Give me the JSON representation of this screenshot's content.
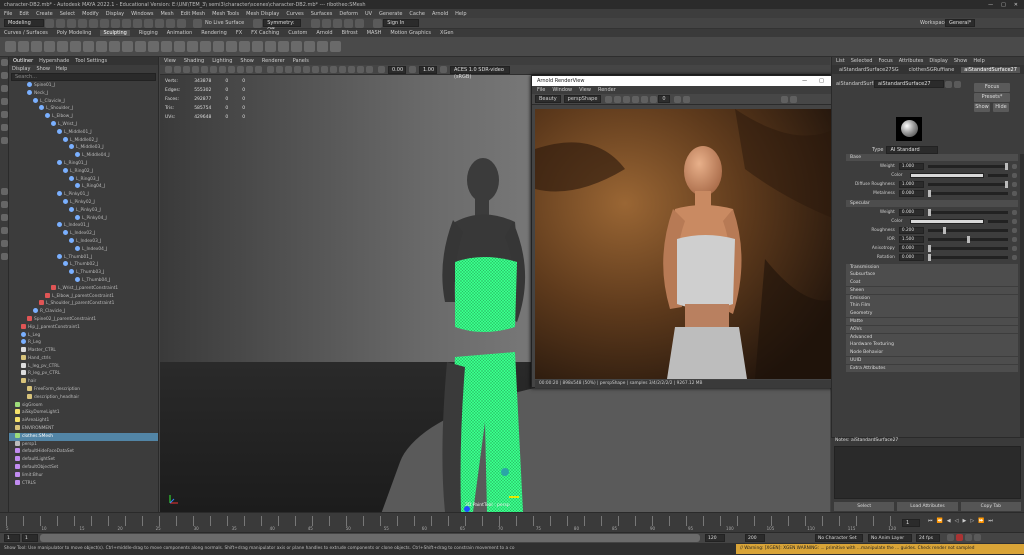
{
  "window": {
    "title": "character-DB2.mb* - Autodesk MAYA 2022.1 - Educational Version: E:\\UNI\\TEM_3\\ semi3\\character\\scenes\\character-DB2.mb* --- ribotheo:SMesh",
    "controls": [
      "—",
      "□",
      "✕"
    ]
  },
  "menubar": [
    "File",
    "Edit",
    "Create",
    "Select",
    "Modify",
    "Display",
    "Windows",
    "Mesh",
    "Edit Mesh",
    "Mesh Tools",
    "Mesh Display",
    "Curves",
    "Surfaces",
    "Deform",
    "UV",
    "Generate",
    "Cache",
    "Arnold",
    "Help"
  ],
  "statusline": {
    "mode": "Modeling",
    "live": "No Live Surface",
    "symmetry": "Symmetry: Off",
    "signin": "Sign In",
    "workspace_label": "Workspace:",
    "workspace": "General*"
  },
  "shelftabs": {
    "items": [
      "Curves / Surfaces",
      "Poly Modeling",
      "Sculpting",
      "Rigging",
      "Animation",
      "Rendering",
      "FX",
      "FX Caching",
      "Custom",
      "Arnold",
      "Bifrost",
      "MASH",
      "Motion Graphics",
      "XGen"
    ],
    "active": "Sculpting"
  },
  "outliner": {
    "tabs": [
      "Outliner",
      "Hypershade",
      "Tool Settings"
    ],
    "active_tab": "Outliner",
    "menu": [
      "Display",
      "Show",
      "Help"
    ],
    "search_placeholder": "Search...",
    "items": [
      {
        "label": "Spine01_J",
        "depth": 2,
        "kind": "joint"
      },
      {
        "label": "Neck_J",
        "depth": 2,
        "kind": "joint"
      },
      {
        "label": "L_Clavicle_J",
        "depth": 3,
        "kind": "joint"
      },
      {
        "label": "L_Shoulder_J",
        "depth": 4,
        "kind": "joint"
      },
      {
        "label": "L_Elbow_J",
        "depth": 5,
        "kind": "joint"
      },
      {
        "label": "L_Wrist_J",
        "depth": 6,
        "kind": "joint"
      },
      {
        "label": "L_Middle01_J",
        "depth": 7,
        "kind": "joint"
      },
      {
        "label": "L_Middle02_J",
        "depth": 8,
        "kind": "joint"
      },
      {
        "label": "L_Middle03_J",
        "depth": 9,
        "kind": "joint"
      },
      {
        "label": "L_Middle04_J",
        "depth": 10,
        "kind": "joint"
      },
      {
        "label": "L_Ring01_J",
        "depth": 7,
        "kind": "joint"
      },
      {
        "label": "L_Ring02_J",
        "depth": 8,
        "kind": "joint"
      },
      {
        "label": "L_Ring03_J",
        "depth": 9,
        "kind": "joint"
      },
      {
        "label": "L_Ring04_J",
        "depth": 10,
        "kind": "joint"
      },
      {
        "label": "L_Pinky01_J",
        "depth": 7,
        "kind": "joint"
      },
      {
        "label": "L_Pinky02_J",
        "depth": 8,
        "kind": "joint"
      },
      {
        "label": "L_Pinky03_J",
        "depth": 9,
        "kind": "joint"
      },
      {
        "label": "L_Pinky04_J",
        "depth": 10,
        "kind": "joint"
      },
      {
        "label": "L_Index01_J",
        "depth": 7,
        "kind": "joint"
      },
      {
        "label": "L_Index02_J",
        "depth": 8,
        "kind": "joint"
      },
      {
        "label": "L_Index03_J",
        "depth": 9,
        "kind": "joint"
      },
      {
        "label": "L_Index04_J",
        "depth": 10,
        "kind": "joint"
      },
      {
        "label": "L_Thumb01_J",
        "depth": 7,
        "kind": "joint"
      },
      {
        "label": "L_Thumb02_J",
        "depth": 8,
        "kind": "joint"
      },
      {
        "label": "L_Thumb03_J",
        "depth": 9,
        "kind": "joint"
      },
      {
        "label": "L_Thumb04_J",
        "depth": 10,
        "kind": "joint"
      },
      {
        "label": "L_Wrist_J_parentConstraint1",
        "depth": 6,
        "kind": "constraint"
      },
      {
        "label": "L_Elbow_J_parentConstraint1",
        "depth": 5,
        "kind": "constraint"
      },
      {
        "label": "L_Shoulder_J_parentConstraint1",
        "depth": 4,
        "kind": "constraint"
      },
      {
        "label": "R_Clavicle_J",
        "depth": 3,
        "kind": "joint"
      },
      {
        "label": "Spine02_J_parentConstraint1",
        "depth": 2,
        "kind": "constraint"
      },
      {
        "label": "Hip_J_parentConstraint1",
        "depth": 1,
        "kind": "constraint"
      },
      {
        "label": "L_Leg",
        "depth": 1,
        "kind": "joint"
      },
      {
        "label": "R_Leg",
        "depth": 1,
        "kind": "joint"
      },
      {
        "label": "Master_CTRL",
        "depth": 1,
        "kind": "curve"
      },
      {
        "label": "Hand_ctrls",
        "depth": 1,
        "kind": "group"
      },
      {
        "label": "L_leg_pv_CTRL",
        "depth": 1,
        "kind": "curve"
      },
      {
        "label": "R_leg_pv_CTRL",
        "depth": 1,
        "kind": "curve"
      },
      {
        "label": "hair",
        "depth": 1,
        "kind": "group"
      },
      {
        "label": "FreeForm_description",
        "depth": 2,
        "kind": "group"
      },
      {
        "label": "description_headhair",
        "depth": 2,
        "kind": "group"
      },
      {
        "label": "sigGroom",
        "depth": 0,
        "kind": "mesh"
      },
      {
        "label": "aiSkyDomeLight1",
        "depth": 0,
        "kind": "light"
      },
      {
        "label": "aiAreaLight1",
        "depth": 0,
        "kind": "light"
      },
      {
        "label": "ENVIRONMENT",
        "depth": 0,
        "kind": "group"
      },
      {
        "label": "clothes:SMesh",
        "depth": 0,
        "kind": "mesh",
        "selected": true
      },
      {
        "label": "persp1",
        "depth": 0,
        "kind": "camera"
      },
      {
        "label": "defaultHideFaceDataSet",
        "depth": 0,
        "kind": "set"
      },
      {
        "label": "defaultLightSet",
        "depth": 0,
        "kind": "set"
      },
      {
        "label": "defaultObjectSet",
        "depth": 0,
        "kind": "set"
      },
      {
        "label": "limit:Bhur",
        "depth": 0,
        "kind": "set"
      },
      {
        "label": "CTRLS",
        "depth": 0,
        "kind": "set"
      }
    ]
  },
  "viewport": {
    "menu": [
      "View",
      "Shading",
      "Lighting",
      "Show",
      "Renderer",
      "Panels"
    ],
    "tool_values": {
      "value1": "0.00",
      "value2": "1.00",
      "colorspace": "ACES 1.0 SDR-video (sRGB)"
    },
    "hud": [
      {
        "label": "Verts:",
        "a": "343878",
        "b": "0",
        "c": "0"
      },
      {
        "label": "Edges:",
        "a": "555302",
        "b": "0",
        "c": "0"
      },
      {
        "label": "Faces:",
        "a": "292877",
        "b": "0",
        "c": "0"
      },
      {
        "label": "Tris:",
        "a": "585754",
        "b": "0",
        "c": "0"
      },
      {
        "label": "UVs:",
        "a": "429648",
        "b": "0",
        "c": "0"
      }
    ],
    "camera": "3D PaintTool : persp"
  },
  "renderview": {
    "title": "Arnold RenderView",
    "controls": [
      "—",
      "□",
      "✕"
    ],
    "menu": [
      "File",
      "Window",
      "View",
      "Render"
    ],
    "toolbar": {
      "mode": "Beauty",
      "camera": "perspShape",
      "exposure": "0"
    },
    "status": "00:00:20 | 898x548 (50%) | perspShape | samples 3/4/2/2/2/2 | 9267.12 MB"
  },
  "attributes": {
    "menu": [
      "List",
      "Selected",
      "Focus",
      "Attributes",
      "Display",
      "Show",
      "Help"
    ],
    "tabs": [
      "aiStandardSurface27SG",
      "clothesSGRuffiane",
      "aiStandardSurface27"
    ],
    "active_tab": "aiStandardSurface27",
    "node_label": "aiStandardSurface:",
    "node_name": "aiStandardSurface27",
    "buttons": {
      "focus": "Focus",
      "presets": "Presets*",
      "show": "Show",
      "hide": "Hide"
    },
    "type_label": "Type",
    "type_value": "AI Standard Surface",
    "base": {
      "header": "Base",
      "params": [
        {
          "label": "Weight",
          "value": "1.000",
          "fill": 1.0
        },
        {
          "label": "Color",
          "swatch": "#d9d9d9"
        },
        {
          "label": "Diffuse Roughness",
          "value": "1.000",
          "fill": 1.0
        },
        {
          "label": "Metalness",
          "value": "0.000",
          "fill": 0.0
        }
      ]
    },
    "specular": {
      "header": "Specular",
      "params": [
        {
          "label": "Weight",
          "value": "0.000",
          "fill": 0.0
        },
        {
          "label": "Color",
          "swatch": "#d9d9d9"
        },
        {
          "label": "Roughness",
          "value": "0.200",
          "fill": 0.2
        },
        {
          "label": "IOR",
          "value": "1.500",
          "fill": 0.5
        },
        {
          "label": "Anisotropy",
          "value": "0.000",
          "fill": 0.0
        },
        {
          "label": "Rotation",
          "value": "0.000",
          "fill": 0.0
        }
      ]
    },
    "sections": [
      "Transmission",
      "Subsurface",
      "Coat",
      "Sheen",
      "Emission",
      "Thin Film",
      "Geometry",
      "Matte",
      "AOVs",
      "Advanced",
      "Hardware Texturing",
      "Node Behavior",
      "UUID",
      "Extra Attributes"
    ],
    "notes_label": "Notes: aiStandardSurface27",
    "bottom_buttons": [
      "Select",
      "Load Attributes",
      "Copy Tab"
    ]
  },
  "timeslider": {
    "labels": [
      "5",
      "10",
      "15",
      "20",
      "25",
      "30",
      "35",
      "40",
      "45",
      "50",
      "55",
      "60",
      "65",
      "70",
      "75",
      "80",
      "85",
      "90",
      "95",
      "100",
      "105",
      "110",
      "115",
      "120"
    ],
    "current": "1"
  },
  "range": {
    "start": "1",
    "start2": "1",
    "end": "120",
    "end2": "200",
    "character_set": "No Character Set",
    "anim_layer": "No Anim Layer",
    "fps": "24 fps"
  },
  "helpline": "Show Tool: Use manipulator to move object(s). Ctrl+middle-drag to move components along normals. Shift+drag manipulator axis or plane handles to extrude components or clone objects. Ctrl+Shift+drag to constrain movement to a co",
  "warning": "// Warning: [XGEN]: XGEN WARNING: ... primitive with ...manipulate the ... guides. Check render not sampled",
  "colors": {
    "selection": "#5285a6",
    "wire": "#39ff8c",
    "warning": "#d9a437"
  }
}
